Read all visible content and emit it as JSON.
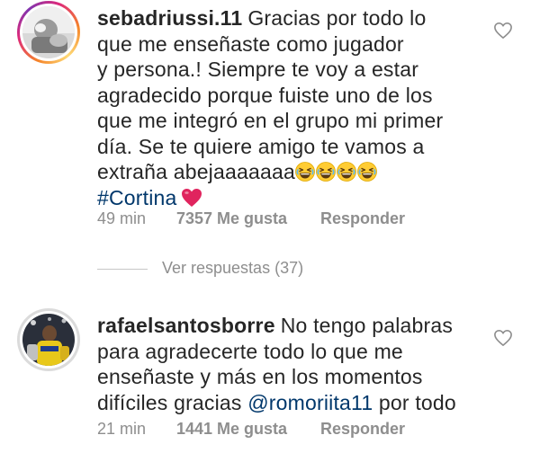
{
  "comments": [
    {
      "username": "sebadriussi.11",
      "lines": [
        "Gracias por todo lo",
        "que me enseñaste como jugador",
        "y persona.! Siempre te voy a estar",
        "agradecido porque fuiste uno de los",
        "que me integró en el grupo mi primer",
        "día. Se te quiere amigo te vamos a",
        "extraña abejaaaaaaa"
      ],
      "emoji": "grinning-squinting-face",
      "emoji_count": 4,
      "hashtag": "#Cortina",
      "time": "49 min",
      "likes": "7357 Me gusta",
      "reply": "Responder"
    },
    {
      "username": "rafaelsantosborre",
      "lines": [
        "No tengo palabras",
        "para agradecerte todo lo que me",
        "enseñaste y más en los momentos",
        "difíciles gracias "
      ],
      "mention": "@romoriita11",
      "after_mention": " por todo",
      "time": "21 min",
      "likes": "1441 Me gusta",
      "reply": "Responder"
    }
  ],
  "view_replies": "Ver respuestas (37)",
  "colors": {
    "text": "#262626",
    "meta": "#8e8e8e",
    "link": "#00376b",
    "heart_emoji": "#e0245e"
  },
  "icons": {
    "like": "heart-outline-icon",
    "emoji": "grinning-squinting-face",
    "heart": "red-heart-emoji"
  }
}
